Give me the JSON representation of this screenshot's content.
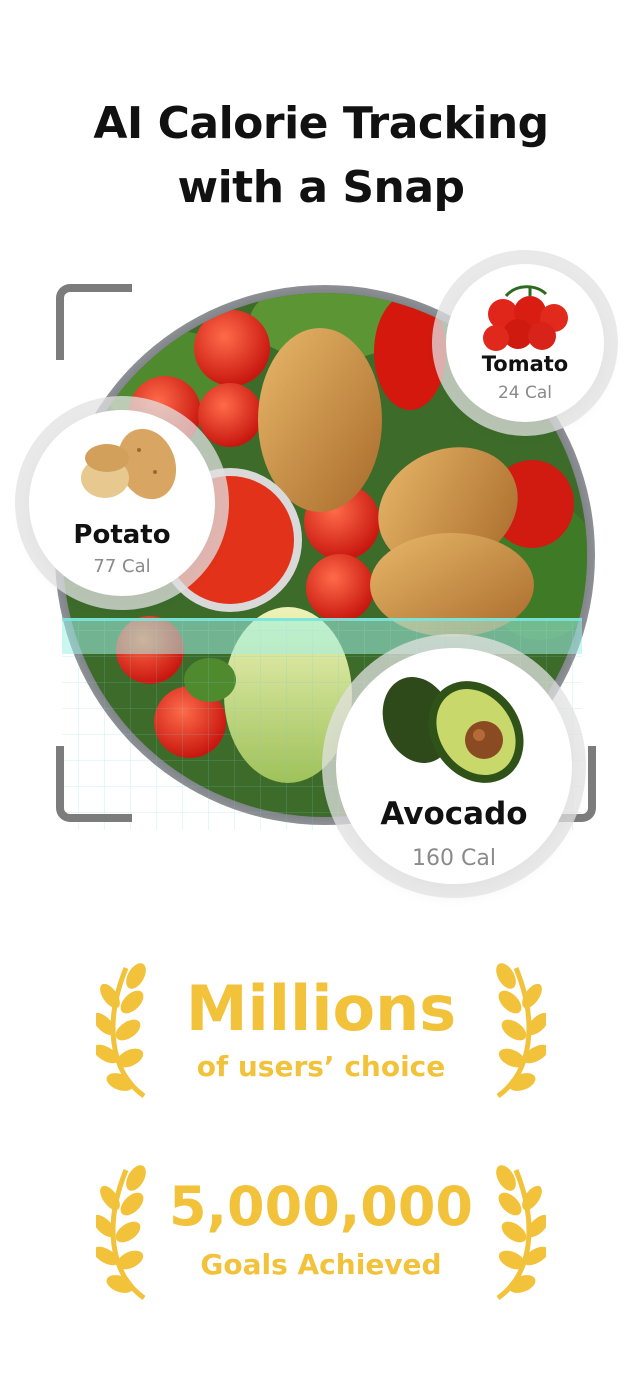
{
  "headline": {
    "line1": "AI Calorie Tracking",
    "line2": "with a Snap"
  },
  "foods": {
    "tomato": {
      "name": "Tomato",
      "calories": "24 Cal",
      "icon": "tomato-icon"
    },
    "potato": {
      "name": "Potato",
      "calories": "77 Cal",
      "icon": "potato-icon"
    },
    "avocado": {
      "name": "Avocado",
      "calories": "160 Cal",
      "icon": "avocado-icon"
    }
  },
  "awards": [
    {
      "big": "Millions",
      "small": "of users’ choice"
    },
    {
      "big": "5,000,000",
      "small": "Goals Achieved"
    }
  ],
  "colors": {
    "gold": "#f2c23a",
    "scan": "#9ff0e6",
    "frame": "#7c7c7c"
  }
}
